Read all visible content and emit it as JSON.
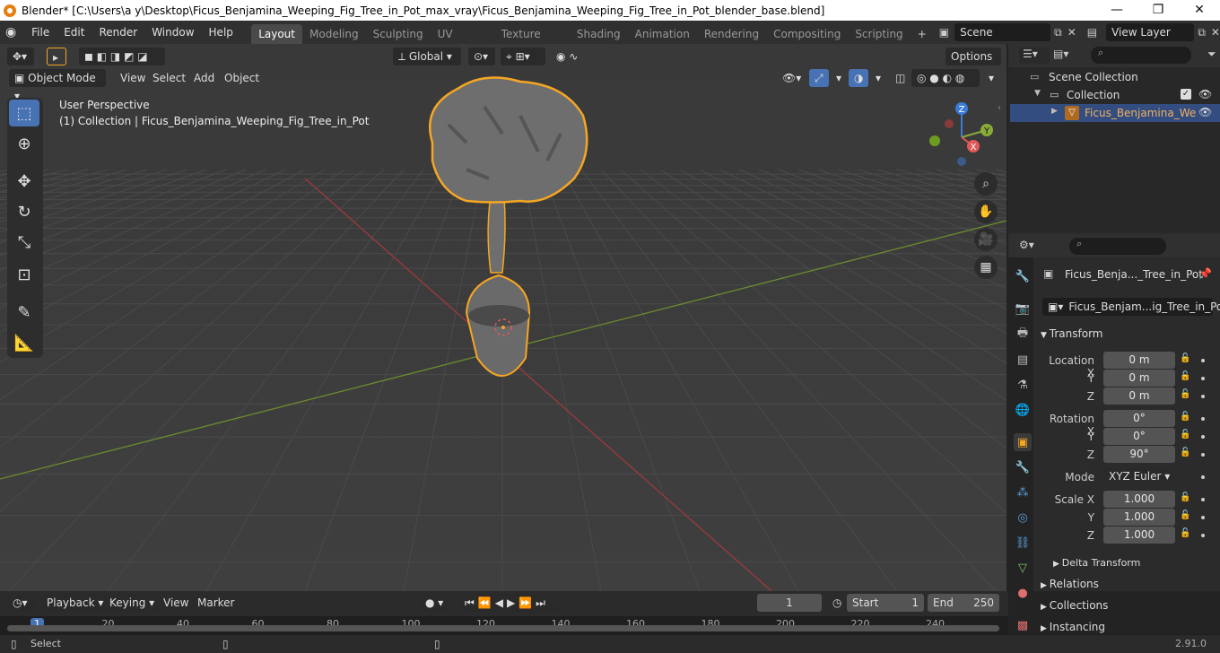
{
  "window": {
    "title": "Blender* [C:\\Users\\a y\\Desktop\\Ficus_Benjamina_Weeping_Fig_Tree_in_Pot_max_vray\\Ficus_Benjamina_Weeping_Fig_Tree_in_Pot_blender_base.blend]",
    "minimize": "—",
    "maximize": "❐",
    "close": "✕"
  },
  "menu": [
    "File",
    "Edit",
    "Render",
    "Window",
    "Help"
  ],
  "workspaces": [
    "Layout",
    "Modeling",
    "Sculpting",
    "UV Editing",
    "Texture Paint",
    "Shading",
    "Animation",
    "Rendering",
    "Compositing",
    "Scripting"
  ],
  "workspace_add": "+",
  "scene": {
    "label": "Scene",
    "view_layer": "View Layer"
  },
  "viewport_header": {
    "transform_orientation": "Global",
    "options": "Options",
    "mode": "Object Mode",
    "menus": [
      "View",
      "Select",
      "Add",
      "Object"
    ]
  },
  "viewport_overlay": {
    "perspective": "User Perspective",
    "collection_info": "(1) Collection | Ficus_Benjamina_Weeping_Fig_Tree_in_Pot"
  },
  "gizmo": {
    "x": "X",
    "y": "Y",
    "z": "Z"
  },
  "outliner": {
    "scene_collection": "Scene Collection",
    "collection": "Collection",
    "object": "Ficus_Benjamina_We"
  },
  "properties": {
    "object_name": "Ficus_Benja..._Tree_in_Pot",
    "data_name": "Ficus_Benjam...ig_Tree_in_Pot",
    "transform_header": "Transform",
    "location": {
      "label": "Location X",
      "x": "0 m",
      "y": "0 m",
      "z": "0 m"
    },
    "rotation": {
      "label": "Rotation X",
      "x": "0°",
      "y": "0°",
      "z": "90°"
    },
    "mode_label": "Mode",
    "mode_value": "XYZ Euler",
    "scale": {
      "label": "Scale X",
      "x": "1.000",
      "y": "1.000",
      "z": "1.000"
    },
    "axis_y": "Y",
    "axis_z": "Z",
    "delta_transform": "Delta Transform",
    "relations": "Relations",
    "collections": "Collections",
    "instancing": "Instancing"
  },
  "timeline": {
    "menus": [
      "Playback",
      "Keying",
      "View",
      "Marker"
    ],
    "current_frame": "1",
    "start_label": "Start",
    "start_value": "1",
    "end_label": "End",
    "end_value": "250",
    "ruler": [
      "1",
      "20",
      "40",
      "60",
      "80",
      "100",
      "120",
      "140",
      "160",
      "180",
      "200",
      "220",
      "240"
    ]
  },
  "status": {
    "select": "Select",
    "version": "2.91.0"
  },
  "colors": {
    "accent": "#4772b3",
    "selection": "#f5a623",
    "x_axis": "#e05a5a",
    "y_axis": "#8aab39",
    "z_axis": "#3b7cd9"
  }
}
